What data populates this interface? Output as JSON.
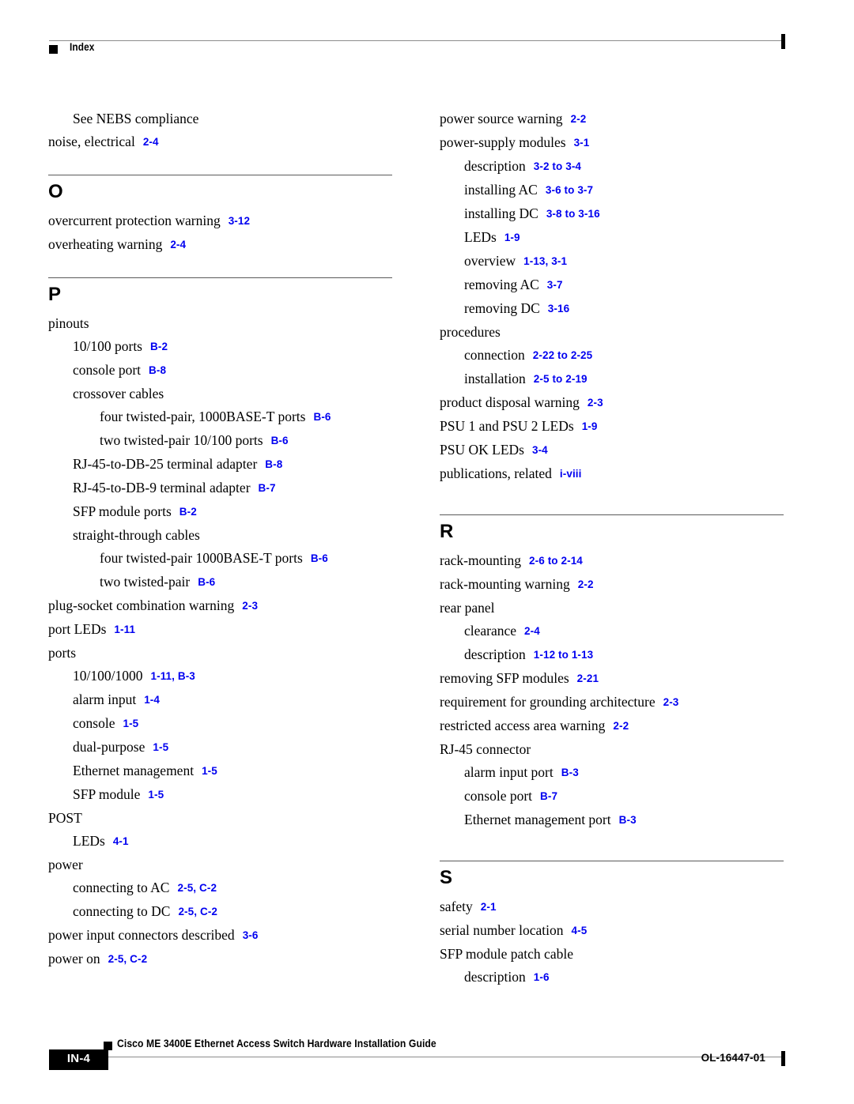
{
  "header": {
    "title": "Index"
  },
  "columns": {
    "left": [
      {
        "kind": "entry",
        "level": 1,
        "term": "See NEBS compliance",
        "ref": ""
      },
      {
        "kind": "entry",
        "level": 0,
        "term": "noise, electrical",
        "ref": "2-4"
      },
      {
        "kind": "gap",
        "size": "md"
      },
      {
        "kind": "letter",
        "letter": "O"
      },
      {
        "kind": "gap",
        "size": "sm"
      },
      {
        "kind": "entry",
        "level": 0,
        "term": "overcurrent protection warning",
        "ref": "3-12"
      },
      {
        "kind": "entry",
        "level": 0,
        "term": "overheating warning",
        "ref": "2-4"
      },
      {
        "kind": "gap",
        "size": "md"
      },
      {
        "kind": "letter",
        "letter": "P"
      },
      {
        "kind": "gap",
        "size": "sm"
      },
      {
        "kind": "entry",
        "level": 0,
        "term": "pinouts",
        "ref": ""
      },
      {
        "kind": "entry",
        "level": 1,
        "term": "10/100 ports",
        "ref": "B-2"
      },
      {
        "kind": "entry",
        "level": 1,
        "term": "console port",
        "ref": "B-8"
      },
      {
        "kind": "entry",
        "level": 1,
        "term": "crossover cables",
        "ref": ""
      },
      {
        "kind": "entry",
        "level": 2,
        "term": "four twisted-pair, 1000BASE-T ports",
        "ref": "B-6"
      },
      {
        "kind": "entry",
        "level": 2,
        "term": "two twisted-pair 10/100 ports",
        "ref": "B-6"
      },
      {
        "kind": "entry",
        "level": 1,
        "term": "RJ-45-to-DB-25 terminal adapter",
        "ref": "B-8"
      },
      {
        "kind": "entry",
        "level": 1,
        "term": "RJ-45-to-DB-9 terminal adapter",
        "ref": "B-7"
      },
      {
        "kind": "entry",
        "level": 1,
        "term": "SFP module ports",
        "ref": "B-2"
      },
      {
        "kind": "entry",
        "level": 1,
        "term": "straight-through cables",
        "ref": ""
      },
      {
        "kind": "entry",
        "level": 2,
        "term": "four twisted-pair 1000BASE-T ports",
        "ref": "B-6"
      },
      {
        "kind": "entry",
        "level": 2,
        "term": "two twisted-pair",
        "ref": "B-6"
      },
      {
        "kind": "entry",
        "level": 0,
        "term": "plug-socket combination warning",
        "ref": "2-3"
      },
      {
        "kind": "entry",
        "level": 0,
        "term": "port LEDs",
        "ref": "1-11"
      },
      {
        "kind": "entry",
        "level": 0,
        "term": "ports",
        "ref": ""
      },
      {
        "kind": "entry",
        "level": 1,
        "term": "10/100/1000",
        "ref": "1-11, B-3"
      },
      {
        "kind": "entry",
        "level": 1,
        "term": "alarm input",
        "ref": "1-4"
      },
      {
        "kind": "entry",
        "level": 1,
        "term": "console",
        "ref": "1-5"
      },
      {
        "kind": "entry",
        "level": 1,
        "term": "dual-purpose",
        "ref": "1-5"
      },
      {
        "kind": "entry",
        "level": 1,
        "term": "Ethernet management",
        "ref": "1-5"
      },
      {
        "kind": "entry",
        "level": 1,
        "term": "SFP module",
        "ref": "1-5"
      },
      {
        "kind": "entry",
        "level": 0,
        "term": "POST",
        "ref": ""
      },
      {
        "kind": "entry",
        "level": 1,
        "term": "LEDs",
        "ref": "4-1"
      },
      {
        "kind": "entry",
        "level": 0,
        "term": "power",
        "ref": ""
      },
      {
        "kind": "entry",
        "level": 1,
        "term": "connecting to AC",
        "ref": "2-5, C-2"
      },
      {
        "kind": "entry",
        "level": 1,
        "term": "connecting to DC",
        "ref": "2-5, C-2"
      },
      {
        "kind": "entry",
        "level": 0,
        "term": "power input connectors described",
        "ref": "3-6"
      },
      {
        "kind": "entry",
        "level": 0,
        "term": "power on",
        "ref": "2-5, C-2"
      }
    ],
    "right": [
      {
        "kind": "entry",
        "level": 0,
        "term": "power source warning",
        "ref": "2-2"
      },
      {
        "kind": "entry",
        "level": 0,
        "term": "power-supply modules",
        "ref": "3-1"
      },
      {
        "kind": "entry",
        "level": 1,
        "term": "description",
        "ref": "3-2 to 3-4"
      },
      {
        "kind": "entry",
        "level": 1,
        "term": "installing AC",
        "ref": "3-6 to 3-7"
      },
      {
        "kind": "entry",
        "level": 1,
        "term": "installing DC",
        "ref": "3-8 to 3-16"
      },
      {
        "kind": "entry",
        "level": 1,
        "term": "LEDs",
        "ref": "1-9"
      },
      {
        "kind": "entry",
        "level": 1,
        "term": "overview",
        "ref": "1-13, 3-1"
      },
      {
        "kind": "entry",
        "level": 1,
        "term": "removing AC",
        "ref": "3-7"
      },
      {
        "kind": "entry",
        "level": 1,
        "term": "removing DC",
        "ref": "3-16"
      },
      {
        "kind": "entry",
        "level": 0,
        "term": "procedures",
        "ref": ""
      },
      {
        "kind": "entry",
        "level": 1,
        "term": "connection",
        "ref": "2-22 to 2-25"
      },
      {
        "kind": "entry",
        "level": 1,
        "term": "installation",
        "ref": "2-5 to 2-19"
      },
      {
        "kind": "entry",
        "level": 0,
        "term": "product disposal warning",
        "ref": "2-3"
      },
      {
        "kind": "entry",
        "level": 0,
        "term": "PSU 1 and PSU 2 LEDs",
        "ref": "1-9"
      },
      {
        "kind": "entry",
        "level": 0,
        "term": "PSU OK LEDs",
        "ref": "3-4"
      },
      {
        "kind": "entry",
        "level": 0,
        "term": "publications, related",
        "ref": "i-viii"
      },
      {
        "kind": "gap",
        "size": "lg"
      },
      {
        "kind": "letter",
        "letter": "R"
      },
      {
        "kind": "gap",
        "size": "sm"
      },
      {
        "kind": "entry",
        "level": 0,
        "term": "rack-mounting",
        "ref": "2-6 to 2-14"
      },
      {
        "kind": "entry",
        "level": 0,
        "term": "rack-mounting warning",
        "ref": "2-2"
      },
      {
        "kind": "entry",
        "level": 0,
        "term": "rear panel",
        "ref": ""
      },
      {
        "kind": "entry",
        "level": 1,
        "term": "clearance",
        "ref": "2-4"
      },
      {
        "kind": "entry",
        "level": 1,
        "term": "description",
        "ref": "1-12 to 1-13"
      },
      {
        "kind": "entry",
        "level": 0,
        "term": "removing SFP modules",
        "ref": "2-21"
      },
      {
        "kind": "entry",
        "level": 0,
        "term": "requirement for grounding architecture",
        "ref": "2-3"
      },
      {
        "kind": "entry",
        "level": 0,
        "term": "restricted access area warning",
        "ref": "2-2"
      },
      {
        "kind": "entry",
        "level": 0,
        "term": "RJ-45 connector",
        "ref": ""
      },
      {
        "kind": "entry",
        "level": 1,
        "term": "alarm input port",
        "ref": "B-3"
      },
      {
        "kind": "entry",
        "level": 1,
        "term": "console port",
        "ref": "B-7"
      },
      {
        "kind": "entry",
        "level": 1,
        "term": "Ethernet management port",
        "ref": "B-3"
      },
      {
        "kind": "gap",
        "size": "lg"
      },
      {
        "kind": "letter",
        "letter": "S"
      },
      {
        "kind": "gap",
        "size": "sm"
      },
      {
        "kind": "entry",
        "level": 0,
        "term": "safety",
        "ref": "2-1"
      },
      {
        "kind": "entry",
        "level": 0,
        "term": "serial number location",
        "ref": "4-5"
      },
      {
        "kind": "entry",
        "level": 0,
        "term": "SFP module patch cable",
        "ref": ""
      },
      {
        "kind": "entry",
        "level": 1,
        "term": "description",
        "ref": "1-6"
      }
    ]
  },
  "footer": {
    "page_number": "IN-4",
    "guide_title": "Cisco ME 3400E Ethernet Access Switch Hardware Installation Guide",
    "doc_id": "OL-16447-01"
  },
  "colors": {
    "reference_blue": "#0000f0",
    "rule_gray": "#8c8c8c",
    "text_black": "#000000"
  }
}
